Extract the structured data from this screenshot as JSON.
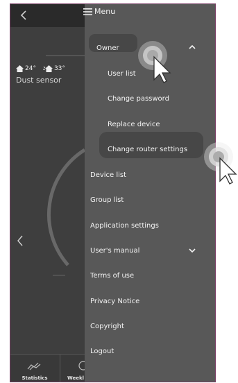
{
  "background": {
    "temperatures": {
      "indoor": "24°",
      "outdoor": "33°"
    },
    "sensor_name": "Dust sensor",
    "bottom_tabs": [
      "Statistics",
      "Weekl"
    ]
  },
  "menu": {
    "title": "Menu",
    "owner": {
      "label": "Owner",
      "subitems": [
        "User list",
        "Change password",
        "Replace device",
        "Change router settings"
      ]
    },
    "items": [
      "Device list",
      "Group list",
      "Application settings",
      "User's manual",
      "Terms of use",
      "Privacy Notice",
      "Copyright",
      "Logout"
    ]
  }
}
